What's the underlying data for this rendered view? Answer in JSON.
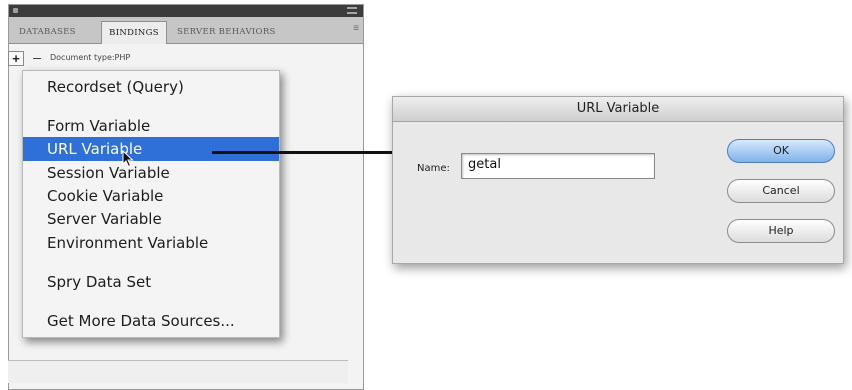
{
  "panel": {
    "tabs": [
      "DATABASES",
      "BINDINGS",
      "SERVER BEHAVIORS"
    ],
    "active_tab": "BINDINGS",
    "plus_label": "+",
    "minus_label": "–",
    "document_type": "Document type:PHP"
  },
  "menu": {
    "items": [
      "Recordset (Query)",
      "Form Variable",
      "URL Variable",
      "Session Variable",
      "Cookie Variable",
      "Server Variable",
      "Environment Variable",
      "Spry Data Set",
      "Get More Data Sources..."
    ],
    "selected": "URL Variable"
  },
  "dialog": {
    "title": "URL Variable",
    "name_label": "Name:",
    "name_value": "getal",
    "ok_label": "OK",
    "cancel_label": "Cancel",
    "help_label": "Help"
  },
  "colors": {
    "selection": "#2f6fd8",
    "ok_button": "#7fb2ea"
  }
}
